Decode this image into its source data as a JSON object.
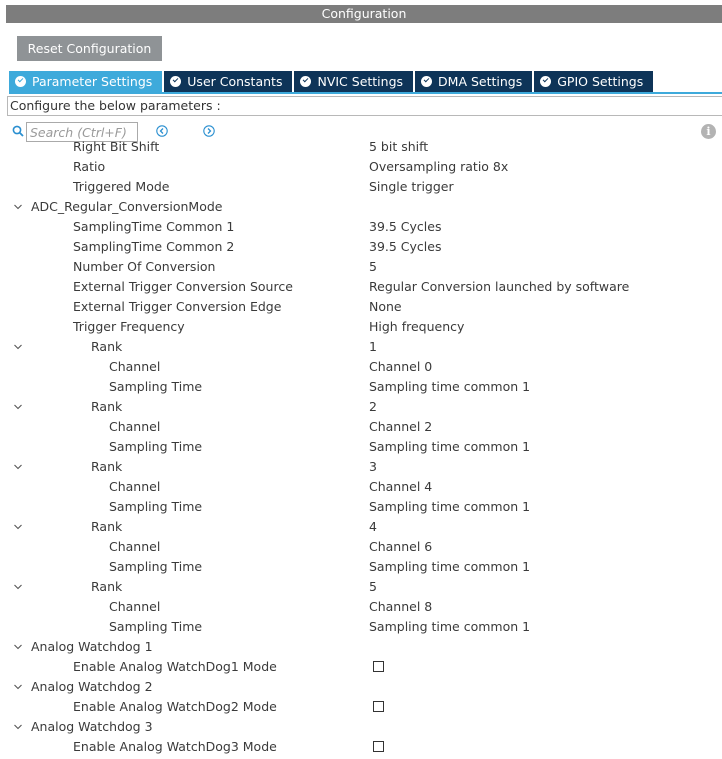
{
  "window": {
    "title": "Configuration"
  },
  "toolbar": {
    "reset_label": "Reset Configuration"
  },
  "tabs": [
    {
      "label": "Parameter Settings",
      "active": true
    },
    {
      "label": "User Constants",
      "active": false
    },
    {
      "label": "NVIC Settings",
      "active": false
    },
    {
      "label": "DMA Settings",
      "active": false
    },
    {
      "label": "GPIO Settings",
      "active": false
    }
  ],
  "description": "Configure the below parameters :",
  "search": {
    "placeholder": "Search (Ctrl+F)"
  },
  "icons": {
    "search": "search-icon",
    "prev": "chevron-left-circle-icon",
    "next": "chevron-right-circle-icon",
    "info": "info-icon",
    "expand": "chevron-down-icon",
    "info_glyph": "i"
  },
  "colors": {
    "active_tab": "#3eaadb",
    "tab": "#0e3458",
    "title_bar": "#7d7d7d",
    "reset_button": "#8f9396"
  },
  "tree": [
    {
      "label": "Right Bit Shift",
      "value": "5 bit shift",
      "level": 2
    },
    {
      "label": "Ratio",
      "value": "Oversampling ratio 8x",
      "level": 2
    },
    {
      "label": "Triggered Mode",
      "value": "Single trigger",
      "level": 2
    },
    {
      "label": "ADC_Regular_ConversionMode",
      "value": "",
      "level": 1,
      "expandable": true
    },
    {
      "label": "SamplingTime Common 1",
      "value": "39.5 Cycles",
      "level": 2
    },
    {
      "label": "SamplingTime Common 2",
      "value": "39.5 Cycles",
      "level": 2
    },
    {
      "label": "Number Of Conversion",
      "value": "5",
      "level": 2
    },
    {
      "label": "External Trigger Conversion Source",
      "value": "Regular Conversion launched by software",
      "level": 2
    },
    {
      "label": "External Trigger Conversion Edge",
      "value": "None",
      "level": 2
    },
    {
      "label": "Trigger Frequency",
      "value": "High frequency",
      "level": 2
    },
    {
      "label": "Rank",
      "value": "1",
      "level": 3,
      "expandable": true
    },
    {
      "label": "Channel",
      "value": "Channel 0",
      "level": 4
    },
    {
      "label": "Sampling Time",
      "value": "Sampling time common 1",
      "level": 4
    },
    {
      "label": "Rank",
      "value": "2",
      "level": 3,
      "expandable": true
    },
    {
      "label": "Channel",
      "value": "Channel 2",
      "level": 4
    },
    {
      "label": "Sampling Time",
      "value": "Sampling time common 1",
      "level": 4
    },
    {
      "label": "Rank",
      "value": "3",
      "level": 3,
      "expandable": true
    },
    {
      "label": "Channel",
      "value": "Channel 4",
      "level": 4
    },
    {
      "label": "Sampling Time",
      "value": "Sampling time common 1",
      "level": 4
    },
    {
      "label": "Rank",
      "value": "4",
      "level": 3,
      "expandable": true
    },
    {
      "label": "Channel",
      "value": "Channel 6",
      "level": 4
    },
    {
      "label": "Sampling Time",
      "value": "Sampling time common 1",
      "level": 4
    },
    {
      "label": "Rank",
      "value": "5",
      "level": 3,
      "expandable": true
    },
    {
      "label": "Channel",
      "value": "Channel 8",
      "level": 4
    },
    {
      "label": "Sampling Time",
      "value": "Sampling time common 1",
      "level": 4
    },
    {
      "label": "Analog Watchdog 1",
      "value": "",
      "level": 1,
      "expandable": true
    },
    {
      "label": "Enable Analog WatchDog1 Mode",
      "value": "",
      "level": 2,
      "checkbox": true,
      "checked": false
    },
    {
      "label": "Analog Watchdog 2",
      "value": "",
      "level": 1,
      "expandable": true
    },
    {
      "label": "Enable Analog WatchDog2 Mode",
      "value": "",
      "level": 2,
      "checkbox": true,
      "checked": false
    },
    {
      "label": "Analog Watchdog 3",
      "value": "",
      "level": 1,
      "expandable": true
    },
    {
      "label": "Enable Analog WatchDog3 Mode",
      "value": "",
      "level": 2,
      "checkbox": true,
      "checked": false
    }
  ]
}
